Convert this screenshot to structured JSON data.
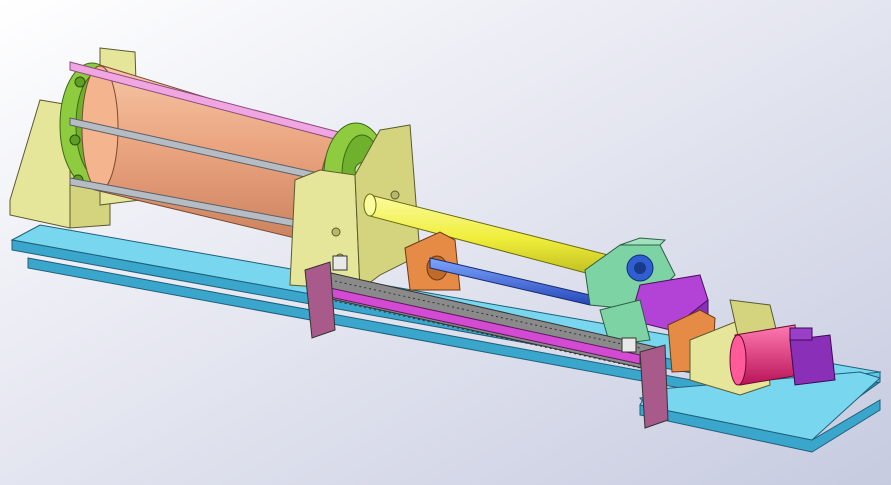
{
  "scene": {
    "description_hidden": "",
    "background_top": "#ffffff",
    "background_bottom": "#c7cbe0"
  },
  "colors": {
    "base_frame": "#5ec7e6",
    "base_frame_dark": "#2f8fb5",
    "drum": "#e9a07c",
    "drum_light": "#f6c6a5",
    "flange": "#8ecb3e",
    "flange_dark": "#5e9f25",
    "support": "#e6e69a",
    "support_dark": "#b8b86a",
    "pink_rod": "#f0a6e0",
    "gray_rod": "#9aa0a8",
    "yellow_shaft": "#f3f23f",
    "blue_shaft": "#3a6fe0",
    "bearing_block": "#7ed3a4",
    "purple_block": "#b243d6",
    "orange_block": "#e58b45",
    "motor": "#e6287a",
    "gearbox": "#8a2fb8",
    "rail": "#d24bd2",
    "rail_frame": "#6f6f6f"
  },
  "icons": [
    "cad-3d-assembly"
  ]
}
